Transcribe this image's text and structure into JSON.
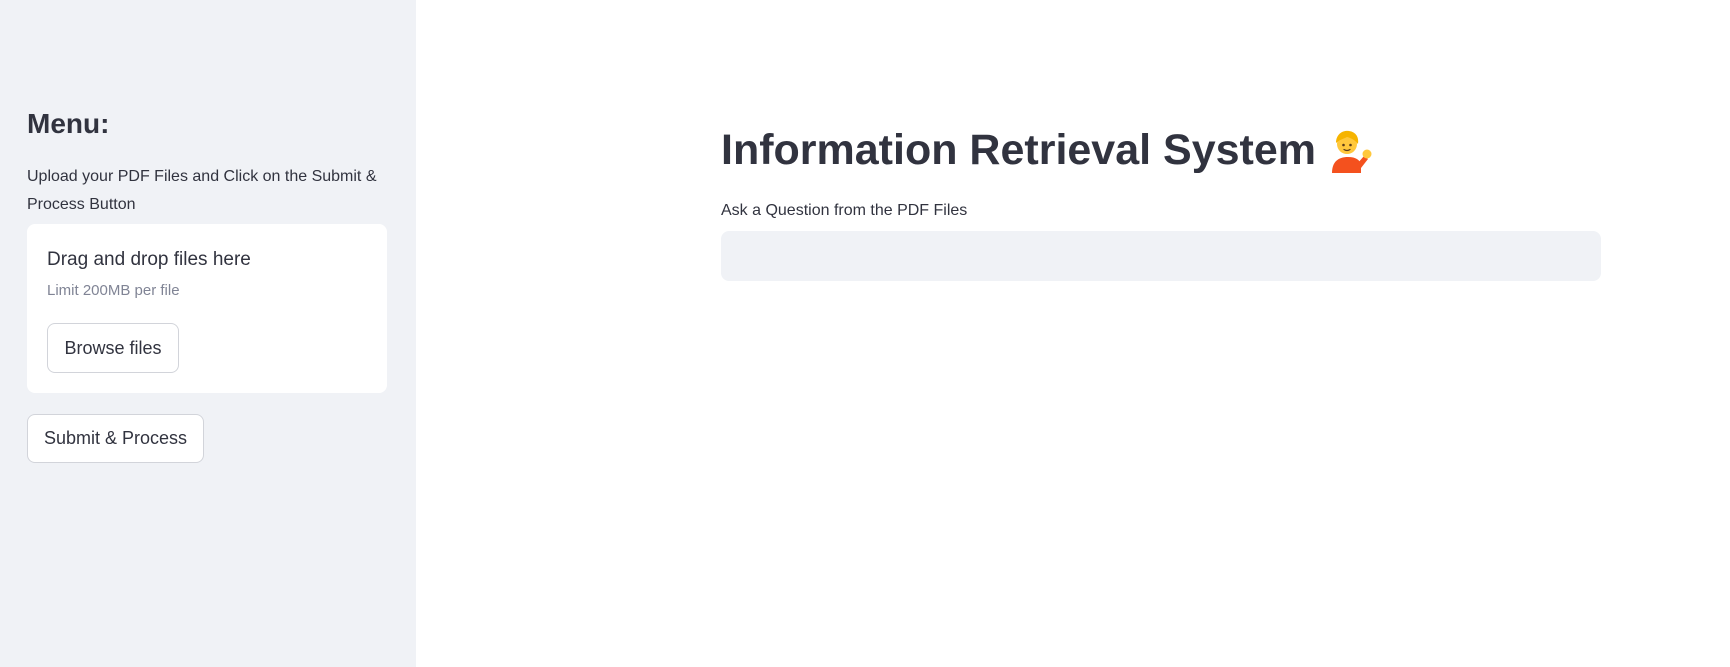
{
  "sidebar": {
    "title": "Menu:",
    "description": "Upload your PDF Files and Click on the Submit & Process Button",
    "uploader": {
      "drop_text": "Drag and drop files here",
      "limit_text": "Limit 200MB per file",
      "browse_label": "Browse files"
    },
    "submit_label": "Submit & Process"
  },
  "main": {
    "title": "Information Retrieval System",
    "title_icon": "person-tipping-hand-emoji",
    "question_label": "Ask a Question from the PDF Files",
    "question_value": "",
    "question_placeholder": ""
  },
  "colors": {
    "sidebar_bg": "#f0f2f6",
    "text": "#31333f",
    "muted_text": "#808495",
    "input_bg": "#f0f2f6"
  }
}
